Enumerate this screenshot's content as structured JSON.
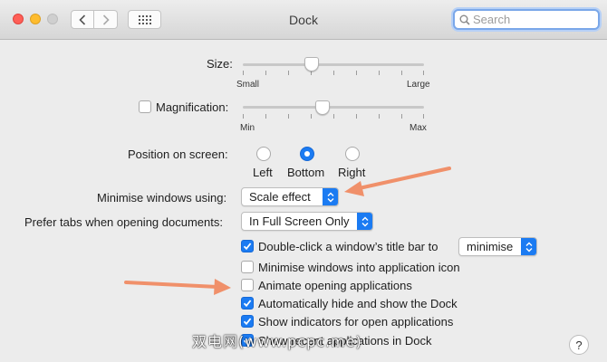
{
  "window": {
    "title": "Dock"
  },
  "search": {
    "placeholder": "Search"
  },
  "size": {
    "label": "Size:",
    "min_label": "Small",
    "max_label": "Large",
    "value": 0.38
  },
  "magnification": {
    "label": "Magnification:",
    "checked": false,
    "min_label": "Min",
    "max_label": "Max",
    "value": 0.44
  },
  "position": {
    "label": "Position on screen:",
    "options": [
      "Left",
      "Bottom",
      "Right"
    ],
    "selected": "Bottom"
  },
  "minimise_using": {
    "label": "Minimise windows using:",
    "value": "Scale effect"
  },
  "prefer_tabs": {
    "label": "Prefer tabs when opening documents:",
    "value": "In Full Screen Only"
  },
  "checkboxes": [
    {
      "label": "Double-click a window’s title bar to",
      "checked": true
    },
    {
      "label": "Minimise windows into application icon",
      "checked": false
    },
    {
      "label": "Animate opening applications",
      "checked": false
    },
    {
      "label": "Automatically hide and show the Dock",
      "checked": true
    },
    {
      "label": "Show indicators for open applications",
      "checked": true
    },
    {
      "label": "Show recent applications in Dock",
      "checked": true
    }
  ],
  "double_click_action": {
    "value": "minimise"
  },
  "help": {
    "label": "?"
  },
  "watermark": {
    "text": "双电网(www.pcpc.me)"
  },
  "colors": {
    "accent": "#1b7bf2",
    "arrow": "#f0906a"
  }
}
